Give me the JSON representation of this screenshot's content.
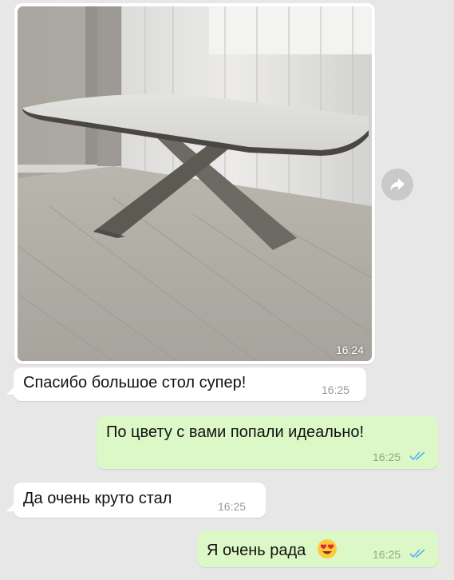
{
  "chat": {
    "photo": {
      "time": "16:24",
      "description_icon": "photo-image"
    },
    "forward_icon": "forward-icon",
    "messages": [
      {
        "direction": "in",
        "text": "Спасибо большое стол супер!",
        "time": "16:25"
      },
      {
        "direction": "out",
        "text": "По цвету с вами попали идеально!",
        "time": "16:25",
        "status": "read"
      },
      {
        "direction": "in",
        "text": "Да очень круто стал",
        "time": "16:25"
      },
      {
        "direction": "out",
        "text": "Я очень рада",
        "emoji": "heart-eyes-emoji",
        "time": "16:25",
        "status": "read"
      }
    ]
  },
  "colors": {
    "background": "#e7e7e8",
    "incoming_bubble": "#ffffff",
    "outgoing_bubble": "#dcf8c6",
    "read_checks": "#4fb3f6"
  }
}
